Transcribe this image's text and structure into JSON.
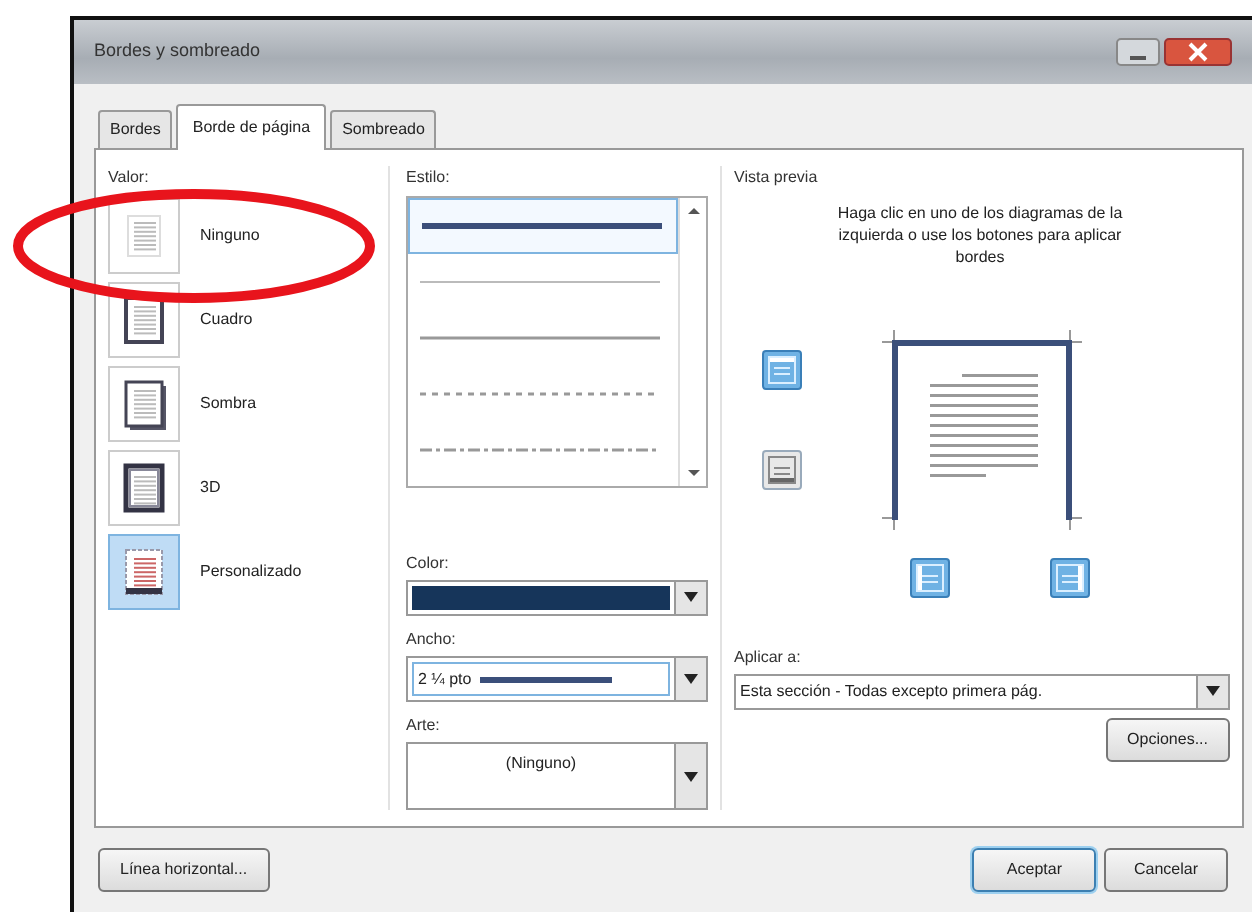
{
  "window": {
    "title": "Bordes y sombreado"
  },
  "tabs": [
    {
      "label": "Bordes",
      "selected": false
    },
    {
      "label": "Borde de página",
      "selected": true
    },
    {
      "label": "Sombreado",
      "selected": false
    }
  ],
  "setting": {
    "label": "Valor:",
    "items": [
      {
        "kind": "none",
        "label": "Ninguno",
        "selected": false
      },
      {
        "kind": "box",
        "label": "Cuadro",
        "selected": false
      },
      {
        "kind": "shadow",
        "label": "Sombra",
        "selected": false
      },
      {
        "kind": "threed",
        "label": "3D",
        "selected": false
      },
      {
        "kind": "custom",
        "label": "Personalizado",
        "selected": true
      }
    ]
  },
  "style": {
    "label": "Estilo:",
    "lines": [
      {
        "kind": "thick",
        "selected": true
      },
      {
        "kind": "thin",
        "selected": false
      },
      {
        "kind": "solid",
        "selected": false
      },
      {
        "kind": "dotted",
        "selected": false
      },
      {
        "kind": "dashdot",
        "selected": false
      }
    ]
  },
  "color": {
    "label": "Color:",
    "color": "#16355a"
  },
  "width": {
    "label": "Ancho:",
    "value": "2 ¼ pto"
  },
  "art": {
    "label": "Arte:",
    "value": "(Ninguno)"
  },
  "preview": {
    "label": "Vista previa",
    "instructions": "Haga clic en uno de los diagramas de la izquierda o use los botones para aplicar bordes",
    "buttons": [
      {
        "kind": "top",
        "on": true
      },
      {
        "kind": "bottom",
        "on": false
      },
      {
        "kind": "left",
        "on": true
      },
      {
        "kind": "right",
        "on": true
      }
    ]
  },
  "apply": {
    "label": "Aplicar a:",
    "value": "Esta sección - Todas excepto primera pág."
  },
  "options_button": "Opciones...",
  "footer": {
    "left_button": "Línea horizontal...",
    "ok_button": "Aceptar",
    "cancel_button": "Cancelar"
  },
  "annotation": {
    "kind": "ellipse",
    "color": "#e8141c"
  }
}
